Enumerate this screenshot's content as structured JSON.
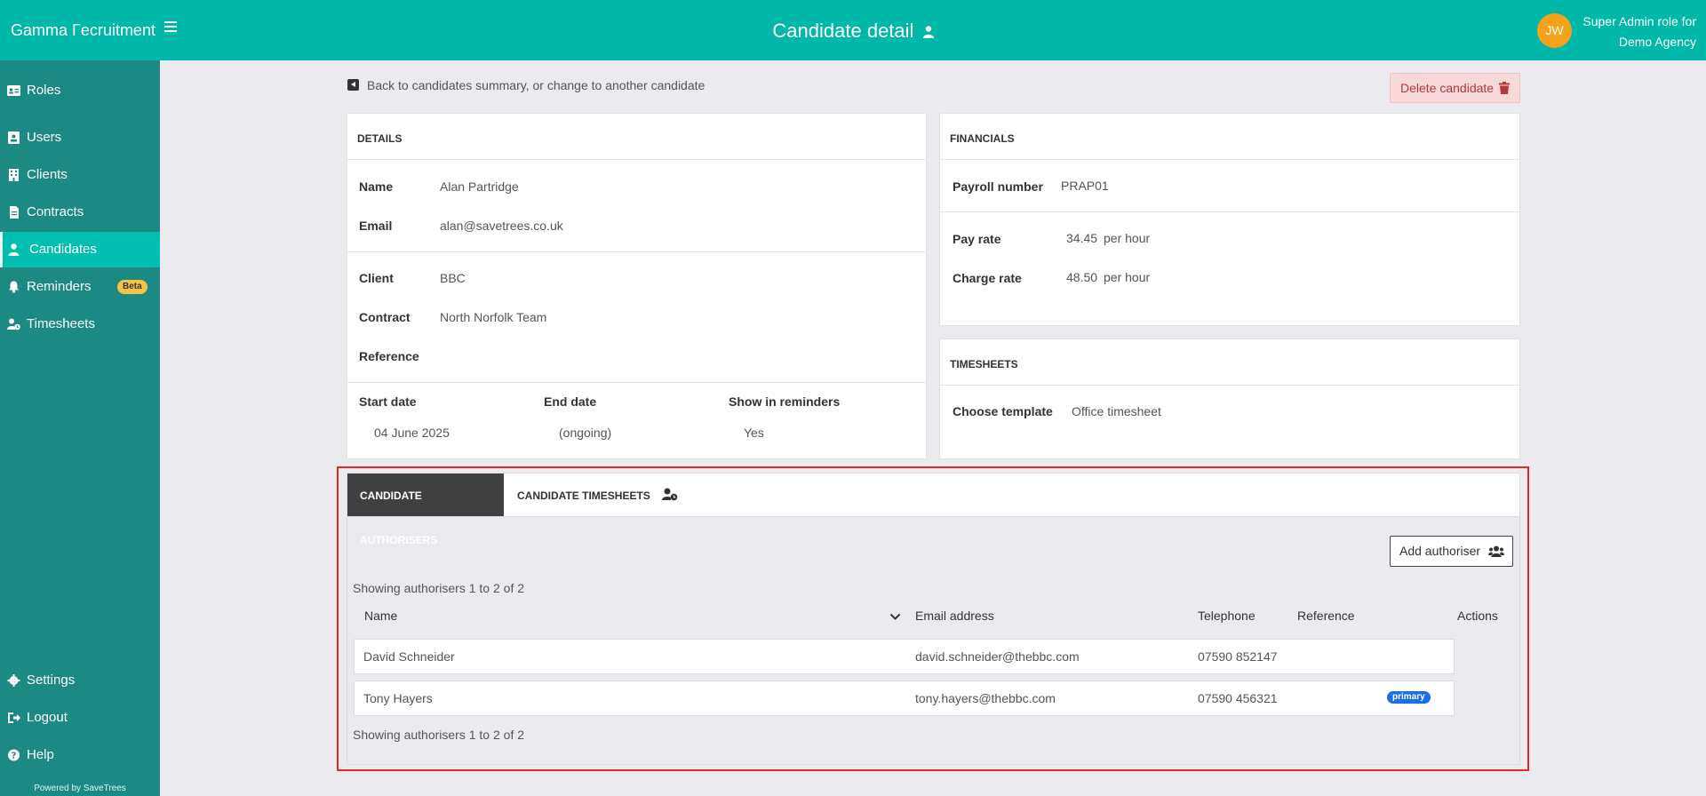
{
  "topbar": {
    "brand": "Gamma Γecruitment",
    "title": "Candidate detail",
    "avatar_initials": "JW",
    "user_role_line1": "Super Admin role for",
    "user_role_line2": "Demo Agency"
  },
  "sidebar": {
    "items": [
      {
        "label": "Roles",
        "icon": "id-card-icon"
      },
      {
        "label": "Users",
        "icon": "user-card-icon"
      },
      {
        "label": "Clients",
        "icon": "building-icon"
      },
      {
        "label": "Contracts",
        "icon": "document-icon"
      },
      {
        "label": "Candidates",
        "icon": "user-icon",
        "active": true
      },
      {
        "label": "Reminders",
        "icon": "bell-icon",
        "badge": "Beta"
      },
      {
        "label": "Timesheets",
        "icon": "user-clock-icon"
      }
    ],
    "bottom_items": [
      {
        "label": "Settings",
        "icon": "gear-icon"
      },
      {
        "label": "Logout",
        "icon": "logout-icon"
      },
      {
        "label": "Help",
        "icon": "question-icon"
      }
    ],
    "powered_by": "Powered by SaveTrees"
  },
  "header": {
    "back_link": "Back to candidates summary, or change to another candidate",
    "delete_button": "Delete candidate"
  },
  "details": {
    "heading": "DETAILS",
    "name_label": "Name",
    "name": "Alan Partridge",
    "email_label": "Email",
    "email": "alan@savetrees.co.uk",
    "client_label": "Client",
    "client": "BBC",
    "contract_label": "Contract",
    "contract": "North Norfolk Team",
    "reference_label": "Reference",
    "reference": "",
    "start_label": "Start date",
    "start": "04 June 2025",
    "end_label": "End date",
    "end": "(ongoing)",
    "reminders_label": "Show in reminders",
    "reminders": "Yes"
  },
  "financials": {
    "heading": "FINANCIALS",
    "payroll_label": "Payroll number",
    "payroll": "PRAP01",
    "pay_label": "Pay rate",
    "pay": "34.45",
    "pay_unit": "per hour",
    "charge_label": "Charge rate",
    "charge": "48.50",
    "charge_unit": "per hour"
  },
  "timesheets": {
    "heading": "TIMESHEETS",
    "template_label": "Choose template",
    "template": "Office timesheet"
  },
  "tabs": {
    "authorisers": "CANDIDATE AUTHORISERS",
    "timesheets": "CANDIDATE TIMESHEETS"
  },
  "authorisers": {
    "add_button": "Add authoriser",
    "showing_top": "Showing authorisers 1 to 2 of 2",
    "showing_bottom": "Showing authorisers 1 to 2 of 2",
    "columns": {
      "name": "Name",
      "email": "Email address",
      "telephone": "Telephone",
      "reference": "Reference",
      "actions": "Actions"
    },
    "rows": [
      {
        "name": "David Schneider",
        "email": "david.schneider@thebbc.com",
        "telephone": "07590 852147",
        "reference": "",
        "badge": ""
      },
      {
        "name": "Tony Hayers",
        "email": "tony.hayers@thebbc.com",
        "telephone": "07590 456321",
        "reference": "",
        "badge": "primary"
      }
    ]
  },
  "colors": {
    "topbar": "#00b8a9",
    "sidebar": "#1b8a82",
    "sidebar_active": "#00bfb1",
    "avatar": "#f7a21b",
    "highlight_border": "#e02828",
    "badge_primary": "#1a6fe6"
  }
}
